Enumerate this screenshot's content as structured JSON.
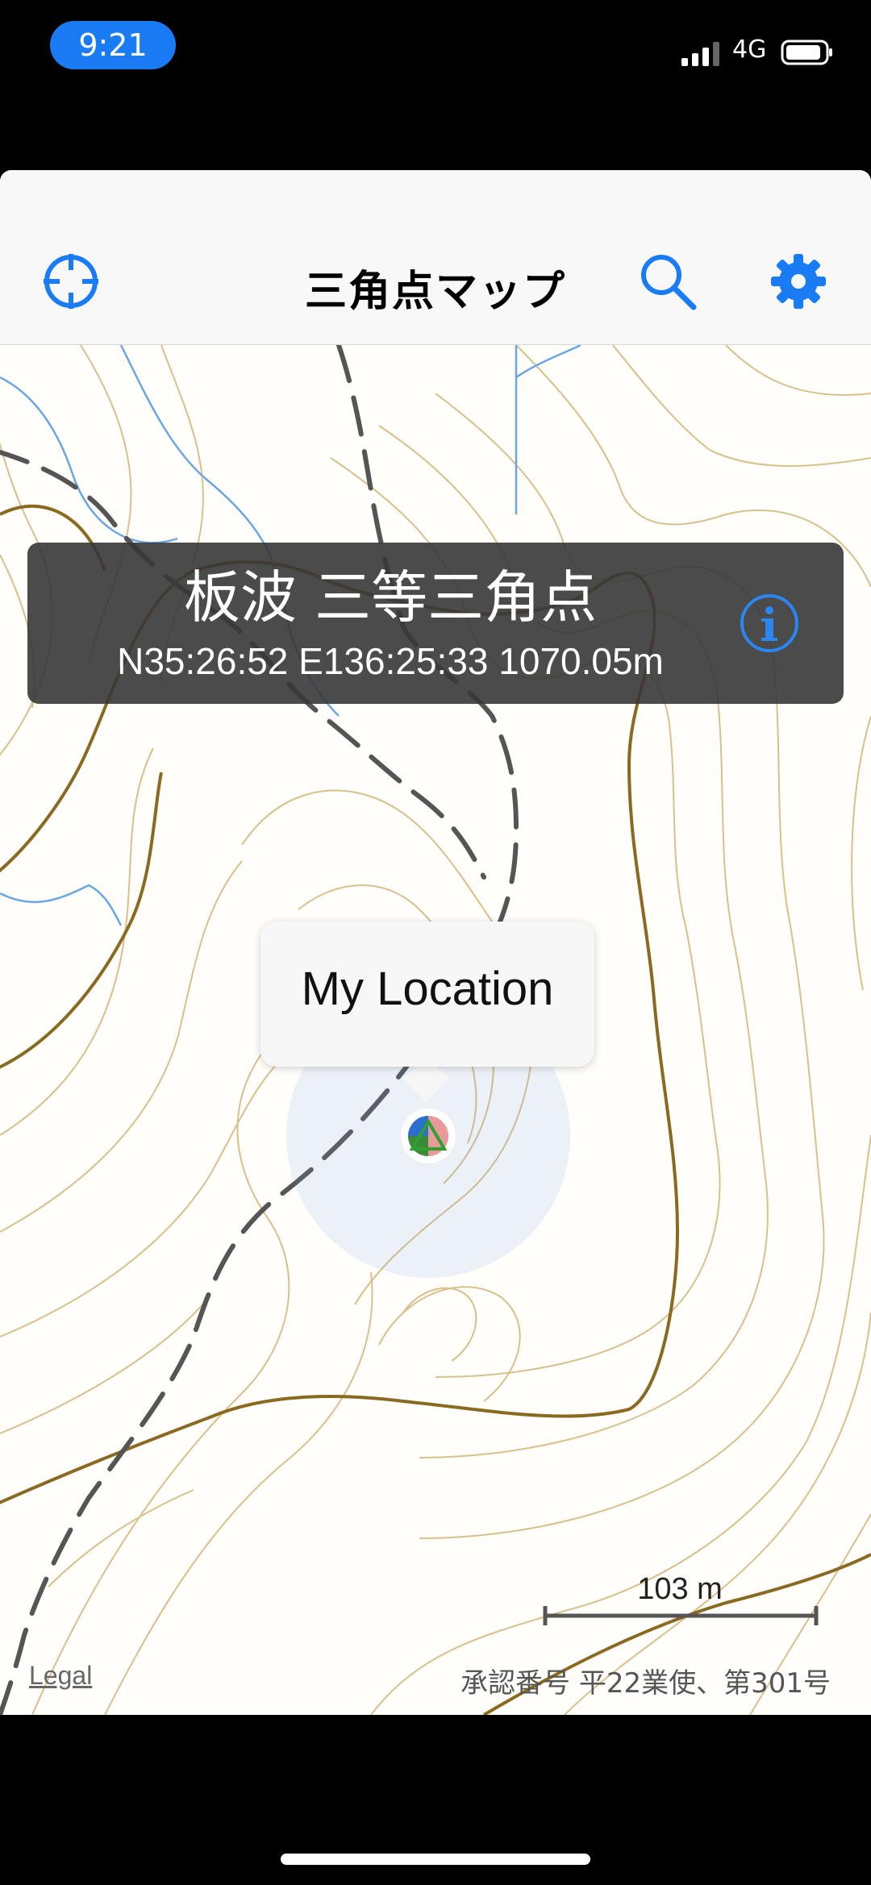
{
  "status_bar": {
    "time": "9:21",
    "network": "4G",
    "icons": [
      "signal-icon",
      "battery-icon"
    ]
  },
  "navbar": {
    "title": "三角点マップ",
    "buttons": [
      "crosshair-icon",
      "search-icon",
      "gear-icon"
    ],
    "accent_color": "#1a7cf5"
  },
  "info_panel": {
    "title": "板波  三等三角点",
    "coordinates": "N35:26:52 E136:25:33 1070.05m",
    "icon": "info-icon"
  },
  "callout": {
    "label": "My Location"
  },
  "map": {
    "scale_label": "103 m",
    "legal": "Legal",
    "attribution": "承認番号 平22業使、第301号",
    "contour_color": "#d9c08a",
    "index_contour_color": "#8a6a20",
    "stream_color": "#6aa6e0",
    "trail_color": "#555555"
  }
}
